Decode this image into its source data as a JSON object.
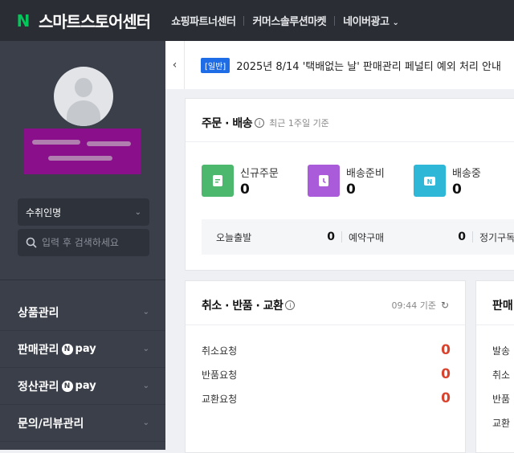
{
  "header": {
    "logo_letter": "N",
    "title": "스마트스토어센터",
    "nav": [
      {
        "label": "쇼핑파트너센터"
      },
      {
        "label": "커머스솔루션마켓"
      },
      {
        "label": "네이버광고"
      }
    ]
  },
  "sidebar": {
    "seller_select": "수취인명",
    "search_placeholder": "입력 후 검색하세요",
    "menu": [
      {
        "label": "상품관리",
        "badge": ""
      },
      {
        "label": "판매관리",
        "badge": "pay"
      },
      {
        "label": "정산관리",
        "badge": "pay"
      },
      {
        "label": "문의/리뷰관리",
        "badge": ""
      }
    ],
    "npay_letter": "N"
  },
  "notice": {
    "tag": "[일반]",
    "text": "2025년 8/14 '택배없는 날' 판매관리 페널티 예외 처리 안내"
  },
  "orders": {
    "title": "주문 · 배송",
    "subtitle": "최근 1주일 기준",
    "stats": [
      {
        "label": "신규주문",
        "value": "0",
        "color": "#4cb86d"
      },
      {
        "label": "배송준비",
        "value": "0",
        "color": "#a95bd9"
      },
      {
        "label": "배송중",
        "value": "0",
        "color": "#2fb7d8"
      }
    ],
    "sub": [
      {
        "label": "오늘출발",
        "value": "0"
      },
      {
        "label": "예약구매",
        "value": "0"
      },
      {
        "label": "정기구독",
        "value": ""
      }
    ]
  },
  "claims": {
    "title": "취소 · 반품 · 교환",
    "time": "09:44 기준",
    "rows": [
      {
        "label": "취소요청",
        "value": "0"
      },
      {
        "label": "반품요청",
        "value": "0"
      },
      {
        "label": "교환요청",
        "value": "0"
      }
    ]
  },
  "third_card": {
    "title": "판매",
    "rows": [
      "발송",
      "취소",
      "반품",
      "교환"
    ]
  }
}
